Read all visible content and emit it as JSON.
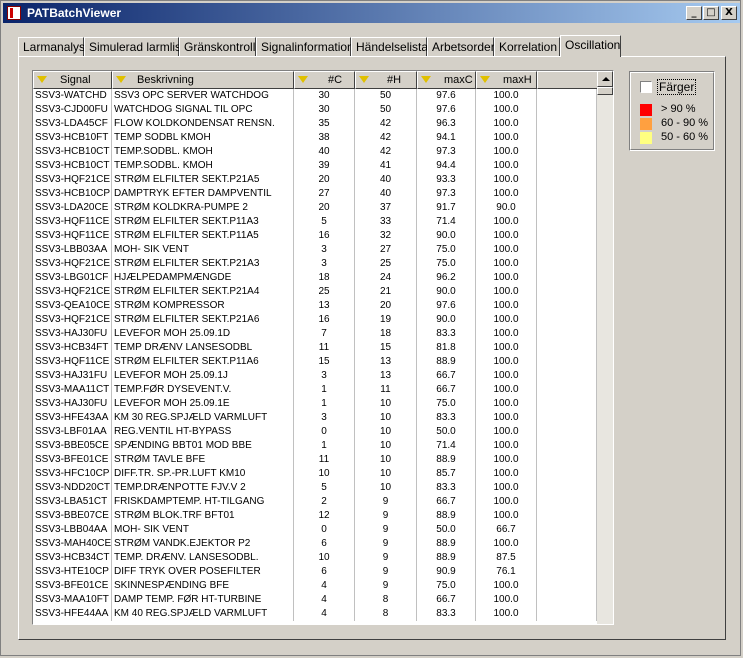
{
  "window": {
    "title": "PATBatchViewer",
    "min_label": "_",
    "max_label": "□",
    "close_label": "X"
  },
  "tabs": [
    {
      "label": "Larmanalys"
    },
    {
      "label": "Simulerad larmlista"
    },
    {
      "label": "Gränskontroll"
    },
    {
      "label": "Signalinformation"
    },
    {
      "label": "Händelselista"
    },
    {
      "label": "Arbetsorder"
    },
    {
      "label": "Korrelation"
    },
    {
      "label": "Oscillation"
    }
  ],
  "active_tab": "Oscillation",
  "table": {
    "columns": [
      "Signal",
      "Beskrivning",
      "#C",
      "#H",
      "maxC",
      "maxH"
    ],
    "rows": [
      [
        "SSV3-WATCHD",
        "SSV3 OPC SERVER WATCHDOG",
        "30",
        "50",
        "97.6",
        "100.0"
      ],
      [
        "SSV3-CJD00FU",
        "WATCHDOG SIGNAL TIL OPC",
        "30",
        "50",
        "97.6",
        "100.0"
      ],
      [
        "SSV3-LDA45CF",
        "FLOW KOLDKONDENSAT RENSN.",
        "35",
        "42",
        "96.3",
        "100.0"
      ],
      [
        "SSV3-HCB10FT",
        "TEMP SODBL KMOH",
        "38",
        "42",
        "94.1",
        "100.0"
      ],
      [
        "SSV3-HCB10CT",
        "TEMP.SODBL. KMOH",
        "40",
        "42",
        "97.3",
        "100.0"
      ],
      [
        "SSV3-HCB10CT",
        "TEMP.SODBL. KMOH",
        "39",
        "41",
        "94.4",
        "100.0"
      ],
      [
        "SSV3-HQF21CE",
        "STRØM ELFILTER SEKT.P21A5",
        "20",
        "40",
        "93.3",
        "100.0"
      ],
      [
        "SSV3-HCB10CP",
        "DAMPTRYK EFTER DAMPVENTIL",
        "27",
        "40",
        "97.3",
        "100.0"
      ],
      [
        "SSV3-LDA20CE",
        "STRØM KOLDKRA-PUMPE 2",
        "20",
        "37",
        "91.7",
        "90.0"
      ],
      [
        "SSV3-HQF11CE",
        "STRØM ELFILTER SEKT.P11A3",
        "5",
        "33",
        "71.4",
        "100.0"
      ],
      [
        "SSV3-HQF11CE",
        "STRØM ELFILTER SEKT.P11A5",
        "16",
        "32",
        "90.0",
        "100.0"
      ],
      [
        "SSV3-LBB03AA",
        "MOH- SIK VENT",
        "3",
        "27",
        "75.0",
        "100.0"
      ],
      [
        "SSV3-HQF21CE",
        "STRØM ELFILTER SEKT.P21A3",
        "3",
        "25",
        "75.0",
        "100.0"
      ],
      [
        "SSV3-LBG01CF",
        "HJÆLPEDAMPMÆNGDE",
        "18",
        "24",
        "96.2",
        "100.0"
      ],
      [
        "SSV3-HQF21CE",
        "STRØM ELFILTER SEKT.P21A4",
        "25",
        "21",
        "90.0",
        "100.0"
      ],
      [
        "SSV3-QEA10CE",
        "STRØM KOMPRESSOR",
        "13",
        "20",
        "97.6",
        "100.0"
      ],
      [
        "SSV3-HQF21CE",
        "STRØM ELFILTER SEKT.P21A6",
        "16",
        "19",
        "90.0",
        "100.0"
      ],
      [
        "SSV3-HAJ30FU",
        "LEVEFOR MOH 25.09.1D",
        "7",
        "18",
        "83.3",
        "100.0"
      ],
      [
        "SSV3-HCB34FT",
        "TEMP DRÆNV LANSESODBL",
        "11",
        "15",
        "81.8",
        "100.0"
      ],
      [
        "SSV3-HQF11CE",
        "STRØM ELFILTER SEKT.P11A6",
        "15",
        "13",
        "88.9",
        "100.0"
      ],
      [
        "SSV3-HAJ31FU",
        "LEVEFOR MOH 25.09.1J",
        "3",
        "13",
        "66.7",
        "100.0"
      ],
      [
        "SSV3-MAA11CT",
        "TEMP.FØR DYSEVENT.V.",
        "1",
        "11",
        "66.7",
        "100.0"
      ],
      [
        "SSV3-HAJ30FU",
        "LEVEFOR MOH 25.09.1E",
        "1",
        "10",
        "75.0",
        "100.0"
      ],
      [
        "SSV3-HFE43AA",
        "KM 30 REG.SPJÆLD VARMLUFT",
        "3",
        "10",
        "83.3",
        "100.0"
      ],
      [
        "SSV3-LBF01AA",
        "REG.VENTIL HT-BYPASS",
        "0",
        "10",
        "50.0",
        "100.0"
      ],
      [
        "SSV3-BBE05CE",
        "SPÆNDING BBT01 MOD BBE",
        "1",
        "10",
        "71.4",
        "100.0"
      ],
      [
        "SSV3-BFE01CE",
        "STRØM TAVLE BFE",
        "11",
        "10",
        "88.9",
        "100.0"
      ],
      [
        "SSV3-HFC10CP",
        "DIFF.TR. SP.-PR.LUFT KM10",
        "10",
        "10",
        "85.7",
        "100.0"
      ],
      [
        "SSV3-NDD20CT",
        "TEMP.DRÆNPOTTE FJV.V 2",
        "5",
        "10",
        "83.3",
        "100.0"
      ],
      [
        "SSV3-LBA51CT",
        "FRISKDAMPTEMP. HT-TILGANG",
        "2",
        "9",
        "66.7",
        "100.0"
      ],
      [
        "SSV3-BBE07CE",
        "STRØM BLOK.TRF BFT01",
        "12",
        "9",
        "88.9",
        "100.0"
      ],
      [
        "SSV3-LBB04AA",
        "MOH- SIK VENT",
        "0",
        "9",
        "50.0",
        "66.7"
      ],
      [
        "SSV3-MAH40CE",
        "STRØM VANDK.EJEKTOR P2",
        "6",
        "9",
        "88.9",
        "100.0"
      ],
      [
        "SSV3-HCB34CT",
        "TEMP. DRÆNV. LANSESODBL.",
        "10",
        "9",
        "88.9",
        "87.5"
      ],
      [
        "SSV3-HTE10CP",
        "DIFF TRYK OVER POSEFILTER",
        "6",
        "9",
        "90.9",
        "76.1"
      ],
      [
        "SSV3-BFE01CE",
        "SKINNESPÆNDING BFE",
        "4",
        "9",
        "75.0",
        "100.0"
      ],
      [
        "SSV3-MAA10FT",
        "DAMP TEMP. FØR HT-TURBINE",
        "4",
        "8",
        "66.7",
        "100.0"
      ],
      [
        "SSV3-HFE44AA",
        "KM 40 REG.SPJÆLD VARMLUFT",
        "4",
        "8",
        "83.3",
        "100.0"
      ]
    ]
  },
  "legend": {
    "checkbox_label": "Färger",
    "checkbox_checked": false,
    "items": [
      {
        "label": "> 90 %",
        "color": "#ff0000"
      },
      {
        "label": "60 - 90 %",
        "color": "#ffa040"
      },
      {
        "label": "50 - 60 %",
        "color": "#ffff80"
      }
    ]
  }
}
